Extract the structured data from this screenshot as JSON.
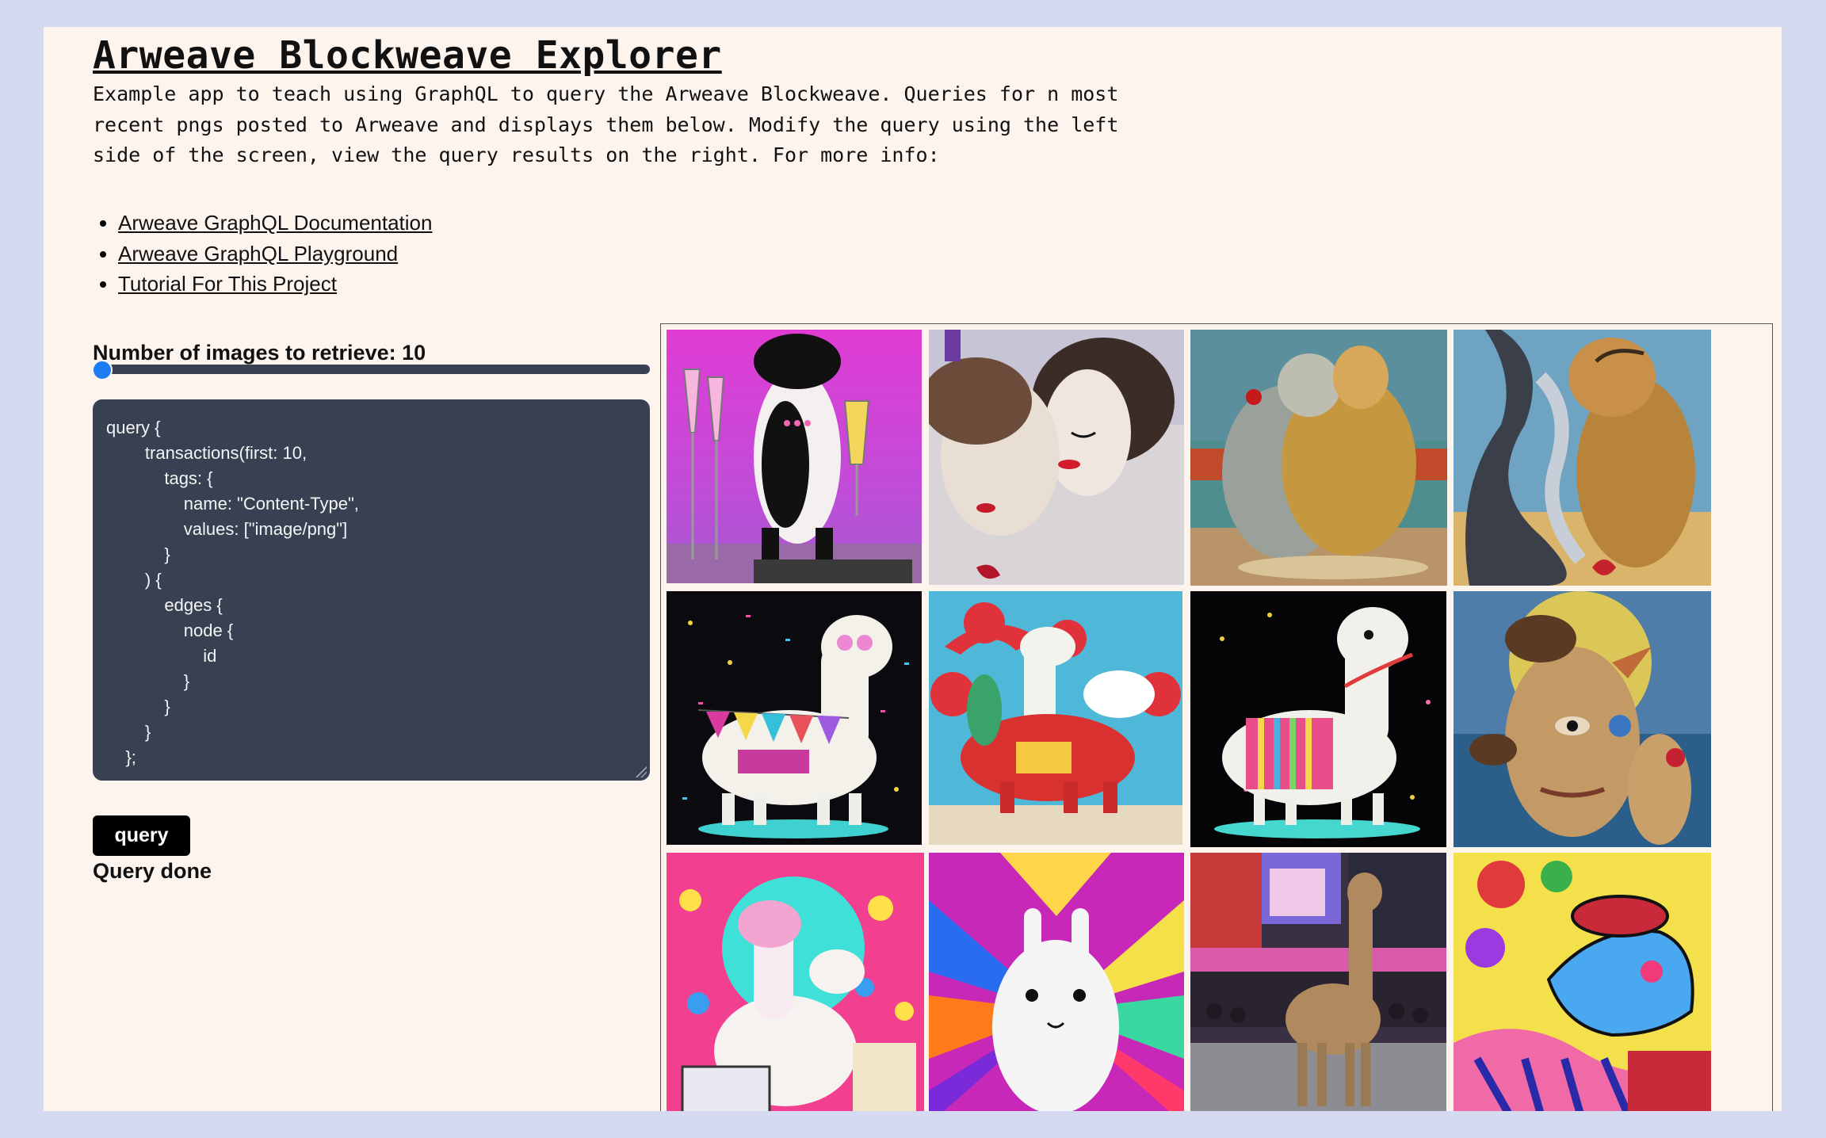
{
  "header": {
    "title": "Arweave Blockweave Explorer",
    "description": "Example app to teach using GraphQL to query the Arweave Blockweave. Queries for n most recent pngs posted to Arweave and displays them below. Modify the query using the left side of the screen, view the query results on the right. For more info:",
    "links": [
      {
        "label": "Arweave GraphQL Documentation"
      },
      {
        "label": "Arweave GraphQL Playground"
      },
      {
        "label": "Tutorial For This Project"
      }
    ]
  },
  "controls": {
    "slider_label": "Number of images to retrieve: 10",
    "slider_value": 10,
    "query_lines": [
      "query {",
      "        transactions(first: 10,",
      "            tags: {",
      "                name: \"Content-Type\",",
      "                values: [\"image/png\"]",
      "            }",
      "        ) {",
      "            edges {",
      "                node {",
      "                    id",
      "                }",
      "            }",
      "        }",
      "    };"
    ],
    "query_button": "query",
    "status": "Query done"
  },
  "gallery": {
    "images": [
      {
        "name": "llama-champagne-image"
      },
      {
        "name": "surreal-faces-kiss-image"
      },
      {
        "name": "surreal-couple-image"
      },
      {
        "name": "surreal-melting-figures-image"
      },
      {
        "name": "party-llama-banner-image"
      },
      {
        "name": "lunar-new-year-llama-image"
      },
      {
        "name": "llama-confetti-night-image"
      },
      {
        "name": "surreal-portrait-image"
      },
      {
        "name": "llama-laptop-party-image"
      },
      {
        "name": "psychedelic-llama-image"
      },
      {
        "name": "times-square-llama-image"
      },
      {
        "name": "graffiti-llama-image"
      }
    ]
  }
}
